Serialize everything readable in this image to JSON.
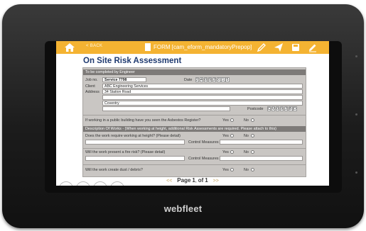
{
  "device": {
    "brand": "webfleet"
  },
  "topbar": {
    "back_label": "< BACK",
    "form_title": "FORM [cam_eform_mandatoryPrepop]",
    "accent": "#f4b332"
  },
  "page_title": "On Site Risk Assessment",
  "form": {
    "engineer_label": "To be completed by Engineer",
    "job_label": "Job no.",
    "job_value": "Service 7798",
    "date_label": "Date",
    "date_digits": [
      "2",
      "4",
      "0",
      "9",
      "2",
      "0",
      "1",
      "5"
    ],
    "client_label": "Client",
    "client_value": "ABC Engineering Services",
    "address_label": "Address",
    "address_line1": "34 Station Road",
    "address_line2": "",
    "address_line3": "Coventry",
    "address_line4": "",
    "postcode_label": "Postcode",
    "postcode_digits": [
      "C",
      "V",
      "0",
      "9",
      "2",
      "B",
      "D"
    ],
    "asbestos_question": "If working in a public building have you seen the Asbestos Register?",
    "yes_label": "Yes",
    "no_label": "No",
    "works_header": "Description Of Works - (When working at height, additional Risk Assessments are required. Please attach to this)",
    "q1": "Does the work require working at height? (Please detail)",
    "q2": "Will the work present a fire risk? (Please detail)",
    "q3": "Will the work create dust / debris?",
    "control_measures_label": "Control Measures"
  },
  "pager": {
    "prev": "<<",
    "page_label": "Page",
    "current": "1",
    "of_label": "of",
    "total": "1",
    "next": ">>"
  }
}
